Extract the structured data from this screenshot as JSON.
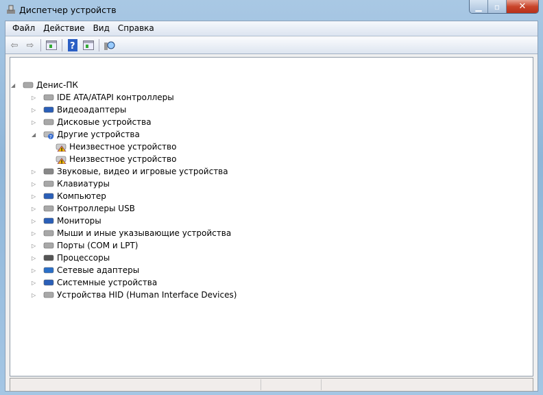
{
  "window": {
    "title": "Диспетчер устройств"
  },
  "menu": [
    "Файл",
    "Действие",
    "Вид",
    "Справка"
  ],
  "toolbar": [
    "back-icon",
    "forward-icon",
    "properties-icon",
    "help-icon",
    "update-driver-icon",
    "scan-hardware-icon"
  ],
  "tree": {
    "root": "Денис-ПК",
    "items": [
      {
        "label": "IDE ATA/ATAPI контроллеры",
        "icon": "ide-controller-icon"
      },
      {
        "label": "Видеоадаптеры",
        "icon": "display-adapter-icon"
      },
      {
        "label": "Дисковые устройства",
        "icon": "disk-drive-icon"
      },
      {
        "label": "Другие устройства",
        "icon": "other-devices-icon",
        "expanded": true,
        "children": [
          "Неизвестное устройство",
          "Неизвестное устройство"
        ]
      },
      {
        "label": "Звуковые, видео и игровые устройства",
        "icon": "speaker-icon"
      },
      {
        "label": "Клавиатуры",
        "icon": "keyboard-icon"
      },
      {
        "label": "Компьютер",
        "icon": "computer-icon"
      },
      {
        "label": "Контроллеры USB",
        "icon": "usb-icon"
      },
      {
        "label": "Мониторы",
        "icon": "monitor-icon"
      },
      {
        "label": "Мыши и иные указывающие устройства",
        "icon": "mouse-icon"
      },
      {
        "label": "Порты (COM и LPT)",
        "icon": "port-icon"
      },
      {
        "label": "Процессоры",
        "icon": "processor-icon"
      },
      {
        "label": "Сетевые адаптеры",
        "icon": "network-adapter-icon"
      },
      {
        "label": "Системные устройства",
        "icon": "system-devices-icon"
      },
      {
        "label": "Устройства HID (Human Interface Devices)",
        "icon": "hid-icon"
      }
    ]
  }
}
